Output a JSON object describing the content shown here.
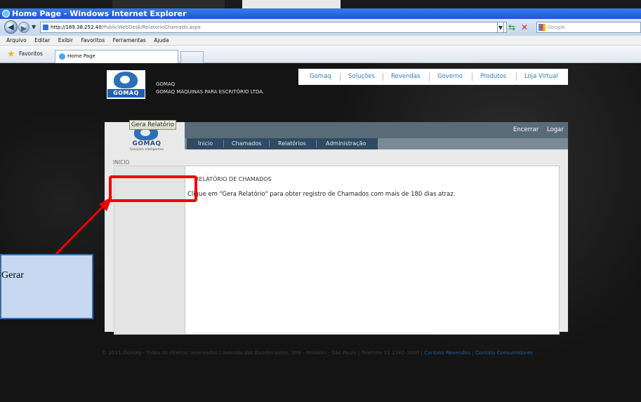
{
  "window": {
    "title": "Home Page - Windows Internet Explorer"
  },
  "address_bar": {
    "url_host": "http://189.38.252.40",
    "url_path": "/PublicWebDesk/RelatorioChamado.aspx"
  },
  "search": {
    "placeholder": "Google"
  },
  "menu_bar": {
    "items": [
      "Arquivo",
      "Editar",
      "Exibir",
      "Favoritos",
      "Ferramentas",
      "Ajuda"
    ]
  },
  "favorites_bar": {
    "favorites_label": "Favoritos",
    "tab_label": "Home Page"
  },
  "site_header": {
    "logo_text": "GOMAQ",
    "brand_name": "GOMAQ",
    "brand_full": "GOMAQ MÁQUINAS PARA ESCRITÓRIO LTDA.",
    "nav": [
      "Gomaq",
      "Soluções",
      "Revendas",
      "Governo",
      "Produtos",
      "Loja Virtual"
    ]
  },
  "panel": {
    "logo_word": "GOMAQ",
    "logo_sub": "Soluções Inteligentes",
    "encerrar": "Encerrar",
    "logar": "Logar",
    "tabs": [
      "Inicio",
      "Chamados",
      "Relatórios",
      "Administração"
    ],
    "breadcrumb": "INICIO",
    "content_title": "RELATÓRIO DE CHAMADOS",
    "content_text": "Clique em \"Gera Relatório\" para obter registro de Chamados com mais de 180 dias atraz.",
    "button_label": "Gera Relatório"
  },
  "footer": {
    "text": "© 2011 Gomaq - Todos os direitos reservados | Avenida dos Bandeirantes, 988 - Brooklin - São Paulo | Telefone 11 2162-1000 |",
    "link_revendas": "Contato Revendas",
    "link_consumidores": "Contato Consumidores",
    "sep": "|"
  },
  "annotation": {
    "callout_text": "Gerar"
  },
  "colors": {
    "highlight": "#f20000",
    "callout_bg": "#c6d9f1",
    "link": "#2c7bb8"
  }
}
